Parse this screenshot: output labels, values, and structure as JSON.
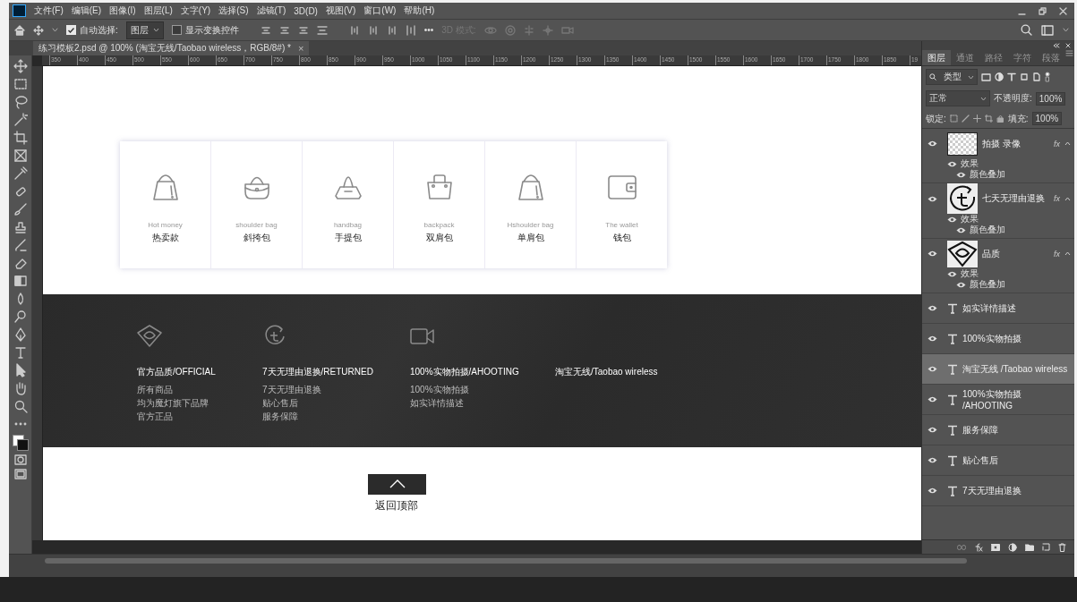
{
  "menubar": {
    "items": [
      "文件(F)",
      "编辑(E)",
      "图像(I)",
      "图层(L)",
      "文字(Y)",
      "选择(S)",
      "滤镜(T)",
      "3D(D)",
      "视图(V)",
      "窗口(W)",
      "帮助(H)"
    ]
  },
  "options_bar": {
    "auto_select": {
      "label": "自动选择:",
      "checked": true
    },
    "target": {
      "value": "图层"
    },
    "transform": {
      "label": "显示变换控件",
      "checked": false
    },
    "more": "•••",
    "mode_3d": {
      "label": "3D 模式:",
      "disabled": true
    }
  },
  "document_tab": {
    "title": "练习模板2.psd @ 100% (淘宝无线/Taobao wireless，RGB/8#) *",
    "close": "×"
  },
  "ruler": {
    "labels": [
      "350",
      "400",
      "450",
      "500",
      "550",
      "600",
      "650",
      "700",
      "750",
      "800",
      "850",
      "900",
      "950",
      "1000",
      "1050",
      "1100",
      "1150",
      "1200",
      "1250",
      "1300",
      "1350",
      "1400",
      "1450",
      "1500",
      "1550",
      "1600",
      "1650",
      "1700",
      "1750",
      "1800",
      "1850",
      "19"
    ]
  },
  "canvas": {
    "categories": [
      {
        "kind": "tote",
        "en": "Hot money",
        "zh": "热卖款"
      },
      {
        "kind": "shoulder",
        "en": "shoulder bag",
        "zh": "斜挎包"
      },
      {
        "kind": "handbag",
        "en": "handbag",
        "zh": "手提包"
      },
      {
        "kind": "backpack",
        "en": "backpack",
        "zh": "双肩包"
      },
      {
        "kind": "tote",
        "en": "Hshoulder bag",
        "zh": "单肩包"
      },
      {
        "kind": "wallet",
        "en": "The wallet",
        "zh": "钱包"
      }
    ],
    "features": [
      {
        "kind": "diamond",
        "title": "官方品质/OFFICIAL",
        "lines": [
          "所有商品",
          "均为魔灯旗下品牌",
          "官方正品"
        ]
      },
      {
        "kind": "return",
        "title": "7天无理由退换/RETURNED",
        "lines": [
          "7天无理由退换",
          "贴心售后",
          "服务保障"
        ]
      },
      {
        "kind": "camera",
        "title": "100%实物拍摄/AHOOTING",
        "lines": [
          "100%实物拍摄",
          "如实详情描述"
        ]
      },
      {
        "kind": "plain",
        "title": "淘宝无线/Taobao wireless"
      }
    ],
    "back_to_top": {
      "label": "返回顶部"
    }
  },
  "layers_panel": {
    "tabs": [
      {
        "label": "图层",
        "selected": true
      },
      {
        "label": "通道",
        "selected": false
      },
      {
        "label": "路径",
        "selected": false
      },
      {
        "label": "字符",
        "selected": false
      },
      {
        "label": "段落",
        "selected": false
      }
    ],
    "filter": {
      "value": "类型"
    },
    "blend_mode": {
      "value": "正常"
    },
    "opacity": {
      "label": "不透明度:",
      "value": "100%"
    },
    "lock": {
      "label": "锁定:"
    },
    "fill": {
      "label": "填充:",
      "value": "100%"
    },
    "layers": [
      {
        "kind": "image",
        "name": "拍摄 录像",
        "fx": "fx",
        "visible": true,
        "selected": false,
        "expanded": true,
        "effects_label": "效果",
        "effects": [
          "颜色叠加"
        ]
      },
      {
        "kind": "image",
        "name": "七天无理由退换",
        "fx": "fx",
        "visible": true,
        "selected": false,
        "expanded": true,
        "effects_label": "效果",
        "effects": [
          "颜色叠加"
        ]
      },
      {
        "kind": "image",
        "name": "品质",
        "fx": "fx",
        "visible": true,
        "selected": false,
        "expanded": true,
        "effects_label": "效果",
        "effects": [
          "颜色叠加"
        ]
      },
      {
        "kind": "text",
        "name": "如实详情描述",
        "visible": true,
        "selected": false
      },
      {
        "kind": "text",
        "name": "100%实物拍摄",
        "visible": true,
        "selected": false
      },
      {
        "kind": "text",
        "name": "淘宝无线 /Taobao wireless",
        "visible": true,
        "selected": true
      },
      {
        "kind": "text",
        "name": "100%实物拍摄 /AHOOTING",
        "visible": true,
        "selected": false
      },
      {
        "kind": "text",
        "name": "服务保障",
        "visible": true,
        "selected": false
      },
      {
        "kind": "text",
        "name": "贴心售后",
        "visible": true,
        "selected": false
      },
      {
        "kind": "text",
        "name": "7天无理由退换",
        "visible": true,
        "selected": false
      }
    ]
  }
}
